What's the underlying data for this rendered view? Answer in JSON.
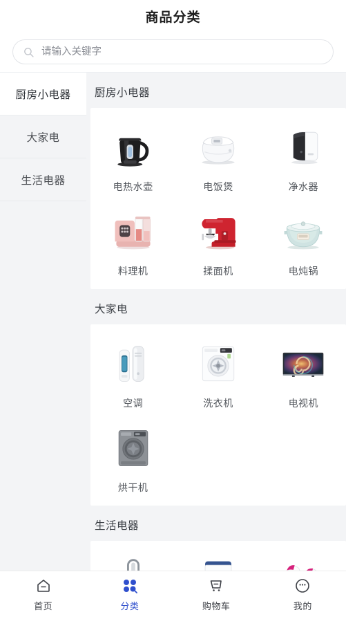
{
  "header": {
    "title": "商品分类"
  },
  "search": {
    "placeholder": "请输入关键字",
    "value": "",
    "icon": "search-icon"
  },
  "sidebar": {
    "active_index": 0,
    "items": [
      {
        "label": "厨房小电器",
        "active": true
      },
      {
        "label": "大家电",
        "active": false
      },
      {
        "label": "生活电器",
        "active": false
      }
    ]
  },
  "content": {
    "sections": [
      {
        "title": "厨房小电器",
        "items": [
          {
            "label": "电热水壶",
            "icon": "electric-kettle-icon"
          },
          {
            "label": "电饭煲",
            "icon": "rice-cooker-icon"
          },
          {
            "label": "净水器",
            "icon": "water-purifier-icon"
          },
          {
            "label": "料理机",
            "icon": "food-processor-icon"
          },
          {
            "label": "揉面机",
            "icon": "stand-mixer-icon"
          },
          {
            "label": "电炖锅",
            "icon": "slow-cooker-icon"
          }
        ]
      },
      {
        "title": "大家电",
        "items": [
          {
            "label": "空调",
            "icon": "air-conditioner-icon"
          },
          {
            "label": "洗衣机",
            "icon": "washing-machine-icon"
          },
          {
            "label": "电视机",
            "icon": "television-icon"
          },
          {
            "label": "烘干机",
            "icon": "clothes-dryer-icon"
          }
        ]
      },
      {
        "title": "生活电器",
        "items": [
          {
            "label": "",
            "icon": "tower-fan-icon"
          },
          {
            "label": "",
            "icon": "humidifier-icon"
          },
          {
            "label": "",
            "icon": "garment-steamer-icon"
          }
        ]
      }
    ]
  },
  "tabbar": {
    "active_index": 1,
    "items": [
      {
        "label": "首页",
        "icon": "home-icon",
        "active": false
      },
      {
        "label": "分类",
        "icon": "category-grid-icon",
        "active": true
      },
      {
        "label": "购物车",
        "icon": "shopping-cart-icon",
        "active": false
      },
      {
        "label": "我的",
        "icon": "profile-face-icon",
        "active": false
      }
    ]
  },
  "colors": {
    "accent": "#2f4fcd",
    "page_bg": "#f3f4f6",
    "card_bg": "#ffffff",
    "text_primary": "#1f1f1f",
    "text_secondary": "#51555b",
    "placeholder": "#8a8d94",
    "border": "#e2e4e8"
  }
}
